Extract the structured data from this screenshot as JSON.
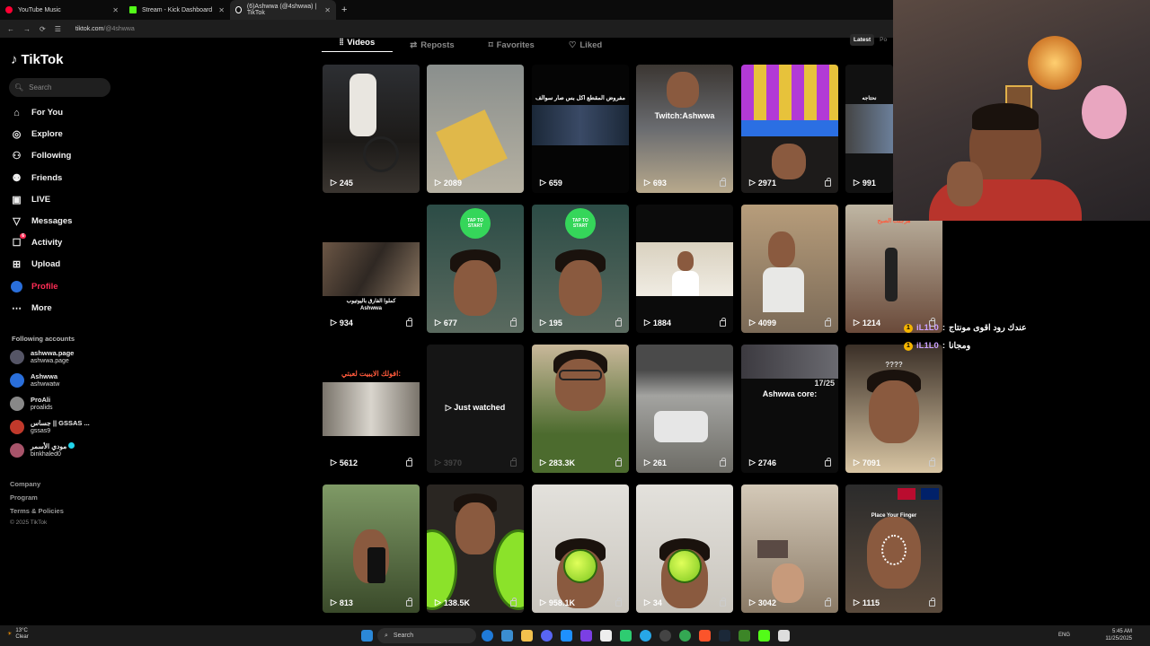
{
  "browser": {
    "tabs": [
      {
        "title": "YouTube Music",
        "color": "#ff0033"
      },
      {
        "title": "Stream - Kick Dashboard",
        "color": "#53fc18"
      },
      {
        "title": "(6)Ashwwa (@4shwwa) | TikTok",
        "color": "#ffffff"
      }
    ],
    "new_tab": "+",
    "url_host": "tiktok.com",
    "url_path": "/@4shwwa"
  },
  "sidebar": {
    "logo": "TikTok",
    "search_placeholder": "Search",
    "nav": [
      {
        "label": "For You",
        "icon": "home-icon"
      },
      {
        "label": "Explore",
        "icon": "compass-icon"
      },
      {
        "label": "Following",
        "icon": "following-icon"
      },
      {
        "label": "Friends",
        "icon": "friends-icon"
      },
      {
        "label": "LIVE",
        "icon": "live-icon"
      },
      {
        "label": "Messages",
        "icon": "messages-icon"
      },
      {
        "label": "Activity",
        "icon": "activity-icon",
        "badge": "6"
      },
      {
        "label": "Upload",
        "icon": "upload-icon"
      },
      {
        "label": "Profile",
        "icon": "profile-avatar"
      },
      {
        "label": "More",
        "icon": "more-icon"
      }
    ],
    "following_title": "Following accounts",
    "accounts": [
      {
        "name": "ashwwa.page",
        "handle": "ashwwa.page"
      },
      {
        "name": "Ashwwa",
        "handle": "ashwwatw"
      },
      {
        "name": "ProAli",
        "handle": "proalids"
      },
      {
        "name": "جساس || GSSAS ...",
        "handle": "gssas9"
      },
      {
        "name": "مودي الأسمر",
        "handle": "binkhaled0",
        "verified": true
      }
    ],
    "footer_links": [
      "Company",
      "Program",
      "Terms & Policies"
    ],
    "copyright": "© 2025 TikTok"
  },
  "profile_tabs": {
    "items": [
      "Videos",
      "Reposts",
      "Favorites",
      "Liked"
    ],
    "active": "Videos",
    "sort": [
      "Latest",
      "Po"
    ]
  },
  "videos": [
    {
      "views": "245",
      "lock": false
    },
    {
      "views": "2089",
      "lock": false
    },
    {
      "views": "659",
      "lock": false,
      "caption": "مفروض المقطع اكل بس صار سوالف"
    },
    {
      "views": "693",
      "lock": true,
      "caption": "Twitch:Ashwwa"
    },
    {
      "views": "2971",
      "lock": true
    },
    {
      "views": "991",
      "lock": false,
      "caption": "نحتاجه"
    },
    {
      "views": "934",
      "lock": true,
      "caption": "كملوا الفارق باليوتيوب\nAshwwa"
    },
    {
      "views": "677",
      "lock": true,
      "caption": "TAP TO START"
    },
    {
      "views": "195",
      "lock": true,
      "caption": "TAP TO START"
    },
    {
      "views": "1884",
      "lock": true
    },
    {
      "views": "4099",
      "lock": true
    },
    {
      "views": "1214",
      "lock": true,
      "caption": "هرجلت الصبح"
    },
    {
      "views": "5612",
      "lock": true,
      "caption": "افولك الايبيت لعبتي:"
    },
    {
      "views": "3970",
      "lock": true,
      "watched": "Just watched"
    },
    {
      "views": "283.3K",
      "lock": true
    },
    {
      "views": "261",
      "lock": true
    },
    {
      "views": "2746",
      "lock": true,
      "caption": "Ashwwa core:",
      "counter": "17/25"
    },
    {
      "views": "7091",
      "lock": true,
      "caption": "????"
    },
    {
      "views": "813",
      "lock": true
    },
    {
      "views": "138.5K",
      "lock": true
    },
    {
      "views": "958.1K",
      "lock": true
    },
    {
      "views": "34",
      "lock": true
    },
    {
      "views": "3042",
      "lock": true
    },
    {
      "views": "1115",
      "lock": true,
      "caption": "Place Your Finger"
    }
  ],
  "chat": [
    {
      "user": "iL1L0",
      "message": "عندك رود اقوى مونتاج"
    },
    {
      "user": "iL1L0",
      "message": "ومجانا"
    }
  ],
  "taskbar": {
    "weather_temp": "13°C",
    "weather_desc": "Clear",
    "search": "Search",
    "lang": "ENG",
    "time": "5:45 AM",
    "date": "11/25/2025"
  }
}
